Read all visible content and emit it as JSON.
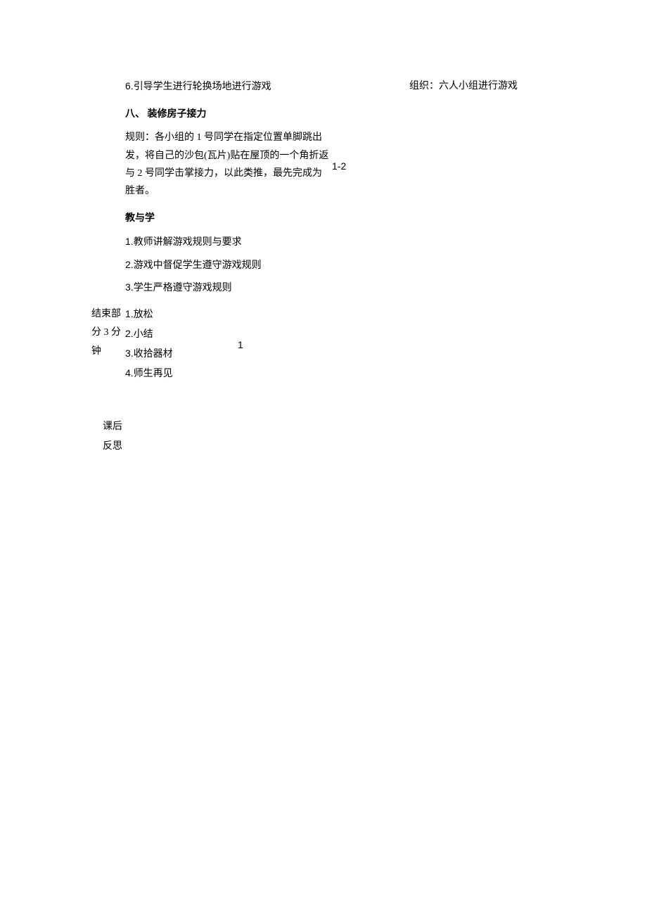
{
  "main": {
    "line_6": "6.引导学生进行轮换场地进行游戏",
    "right_org": "组织：六人小组进行游戏",
    "section_8_title": "八、 装修房子接力",
    "rule_text": "规则：各小组的 1 号同学在指定位置单脚跳出发，将自己的沙包(瓦片)贴在屋顶的一个角折返与 2 号同学击掌接力，以此类推，最先完成为胜者。",
    "rule_num": "1-2",
    "teach_title": "教与学",
    "teach_1": "1.教师讲解游戏规则与要求",
    "teach_2": "2.游戏中督促学生遵守游戏规则",
    "teach_3": "3.学生严格遵守游戏规则"
  },
  "ending": {
    "label_line1": "结束部",
    "label_line2": "分 3 分",
    "label_line3": "钟",
    "item_1": "1.放松",
    "item_2": "2.小结",
    "item_3": "3.收拾器材",
    "item_4": "4.师生再见",
    "num": "1"
  },
  "reflection": {
    "line1": "课后",
    "line2": "反思"
  }
}
